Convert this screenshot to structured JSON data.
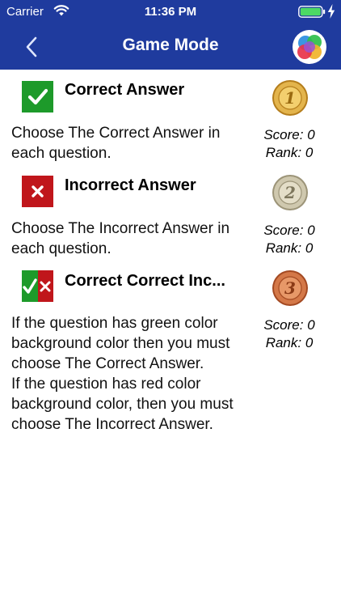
{
  "status_bar": {
    "carrier": "Carrier",
    "time": "11:36 PM",
    "icons": [
      "wifi-icon",
      "battery-icon",
      "charging-bolt-icon"
    ]
  },
  "nav": {
    "title": "Game Mode",
    "back_icon": "chevron-left-icon",
    "logo_icon": "color-wheel-logo"
  },
  "modes": [
    {
      "title": "Correct Answer",
      "icon": "checkmark-green-icon",
      "description": "Choose The Correct Answer in each question.",
      "medal": "gold-medal-1",
      "score": "Score: 0",
      "rank": "Rank: 0"
    },
    {
      "title": "Incorrect Answer",
      "icon": "cross-red-icon",
      "description": "Choose The Incorrect Answer in each question.",
      "medal": "silver-medal-2",
      "score": "Score: 0",
      "rank": "Rank: 0"
    },
    {
      "title": "Correct Correct Inc...",
      "icon": "check-and-cross-icon",
      "description_lines": [
        "If the question has green color background color then you must choose The Correct Answer.",
        "If the question has red color background color, then you must choose The Incorrect Answer."
      ],
      "medal": "bronze-medal-3",
      "score": "Score: 0",
      "rank": "Rank: 0"
    }
  ],
  "colors": {
    "header_bg": "#1f3b9e",
    "correct_green": "#1d9a2a",
    "incorrect_red": "#c0161b",
    "gold": "#d9a83a",
    "silver": "#c9c3ac",
    "bronze": "#c9693a"
  }
}
